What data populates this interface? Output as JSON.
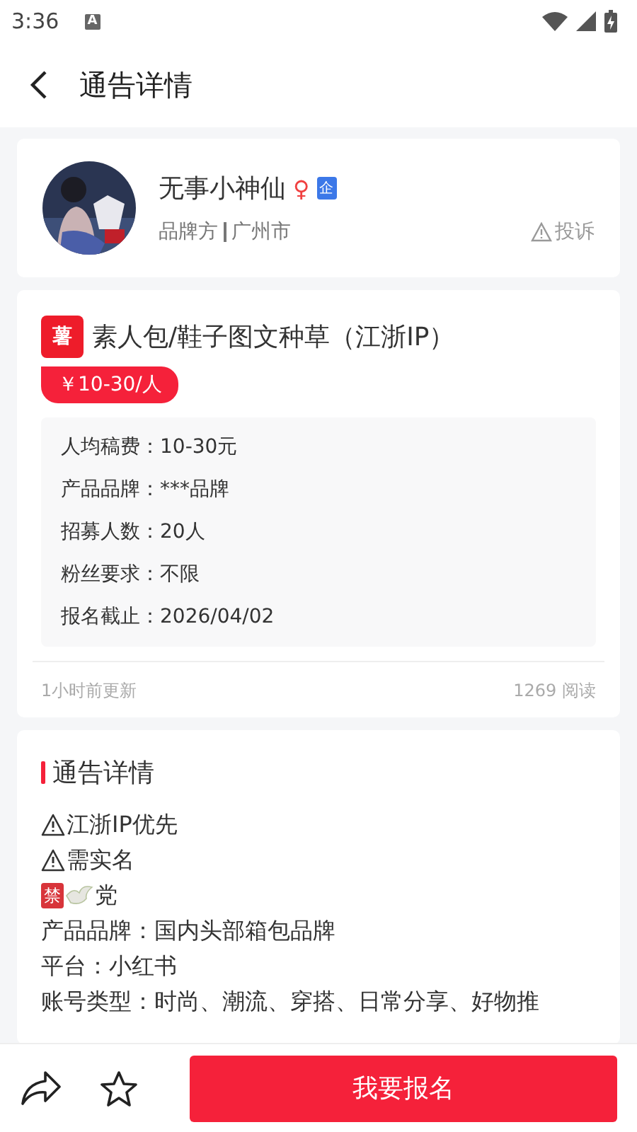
{
  "status_bar": {
    "time": "3:36",
    "notification": "A"
  },
  "header": {
    "title": "通告详情"
  },
  "publisher": {
    "name": "无事小神仙",
    "gender_icon": "♀",
    "badge": "企",
    "role": "品牌方",
    "city": "广州市",
    "report": "投诉"
  },
  "task": {
    "platform_badge": "薯",
    "title": "素人包/鞋子图文种草（江浙IP）",
    "price": "￥10-30/人",
    "info": [
      {
        "label": "人均稿费：",
        "value": "10-30元"
      },
      {
        "label": "产品品牌：",
        "value": "***品牌"
      },
      {
        "label": "招募人数：",
        "value": "20人"
      },
      {
        "label": "粉丝要求：",
        "value": "不限"
      },
      {
        "label": "报名截止：",
        "value": "2026/04/02"
      }
    ],
    "updated": "1小时前更新",
    "reads": "1269 阅读"
  },
  "details": {
    "heading": "通告详情",
    "lines": [
      {
        "kind": "warning",
        "text": "江浙IP优先"
      },
      {
        "kind": "warning",
        "text": "需实名"
      },
      {
        "kind": "ban",
        "badge": "禁",
        "text": "党"
      },
      {
        "kind": "text",
        "text": "产品品牌：国内头部箱包品牌"
      },
      {
        "kind": "text",
        "text": "平台：小红书"
      },
      {
        "kind": "text",
        "text": "账号类型：时尚、潮流、穿搭、日常分享、好物推"
      }
    ]
  },
  "bottom_bar": {
    "apply_button": "我要报名"
  }
}
